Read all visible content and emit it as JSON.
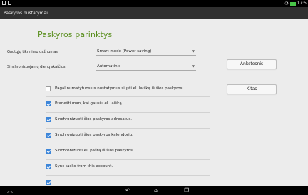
{
  "statusbar": {
    "time": "17:5"
  },
  "actionbar": {
    "title": "Paskyros nustatymai"
  },
  "page": {
    "title": "Paskyros parinktys"
  },
  "fields": [
    {
      "label": "Gautųjų tikrinimo dažnumas",
      "value": "Smart mode (Power saving)"
    },
    {
      "label": "Sinchronizuojamų dienų skaičius",
      "value": "Automatinis"
    }
  ],
  "buttons": {
    "back": "Ankstesnis",
    "next": "Kitas"
  },
  "options": [
    {
      "label": "Pagal numatytuosius nustatymus siųsti el. laišką iš šios paskyros.",
      "checked": false
    },
    {
      "label": "Pranešti man, kai gausiu el. laišką.",
      "checked": true
    },
    {
      "label": "Sinchronizuoti šios paskyros adresatus.",
      "checked": true
    },
    {
      "label": "Sinchronizuoti šios paskyros kalendorių.",
      "checked": true
    },
    {
      "label": "Sinchronizuoti el. paštą iš šios paskyros.",
      "checked": true
    },
    {
      "label": "Sync tasks from this account.",
      "checked": true
    },
    {
      "label": "",
      "checked": true
    }
  ]
}
